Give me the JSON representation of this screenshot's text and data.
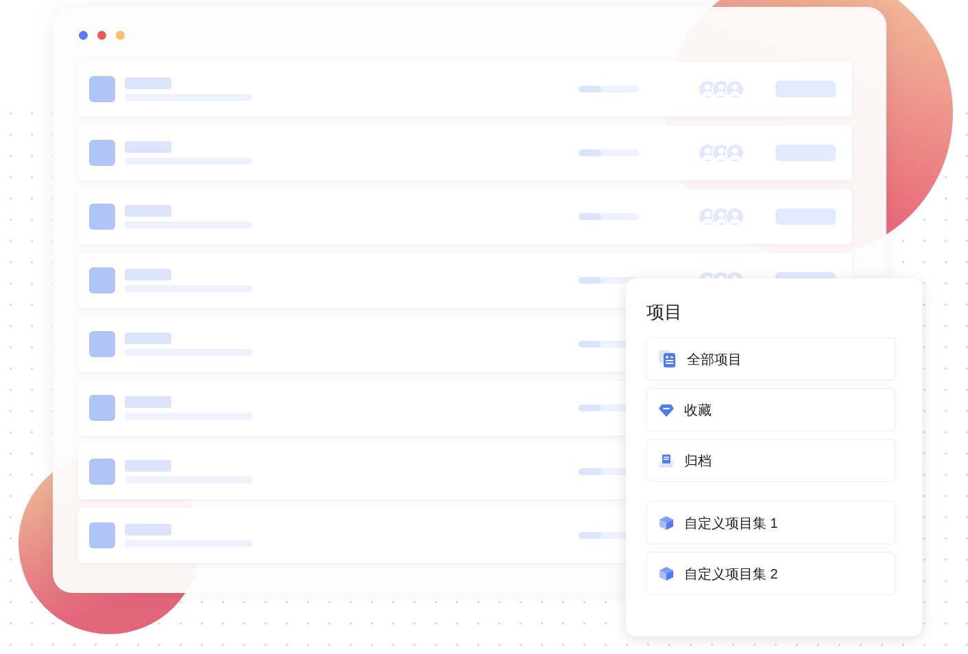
{
  "window": {
    "dots": [
      {
        "color": "#5b7cf0"
      },
      {
        "color": "#e85a5a"
      },
      {
        "color": "#f5c26b"
      }
    ]
  },
  "rows": [
    {
      "progress": {
        "level": 0.37
      },
      "members": true,
      "action": true
    },
    {
      "progress": {
        "level": 0.37
      },
      "members": true,
      "action": true
    },
    {
      "progress": {
        "level": 0.37
      },
      "members": true,
      "action": true
    },
    {
      "progress": {
        "level": 0.37
      },
      "members": true,
      "action": true
    },
    {
      "progress": {
        "level": 0.37
      }
    },
    {
      "progress": {
        "level": 0.37
      }
    },
    {
      "progress": {
        "level": 0.37
      }
    },
    {
      "progress": {
        "level": 0.37
      }
    }
  ],
  "panel": {
    "title": "项目",
    "groups": [
      [
        {
          "label": "全部项目",
          "kind": "list"
        },
        {
          "label": "收藏",
          "kind": "gem"
        },
        {
          "label": "归档",
          "kind": "archive"
        }
      ],
      [
        {
          "label": "自定义项目集 1",
          "kind": "cube"
        },
        {
          "label": "自定义项目集 2",
          "kind": "cube"
        }
      ]
    ]
  }
}
